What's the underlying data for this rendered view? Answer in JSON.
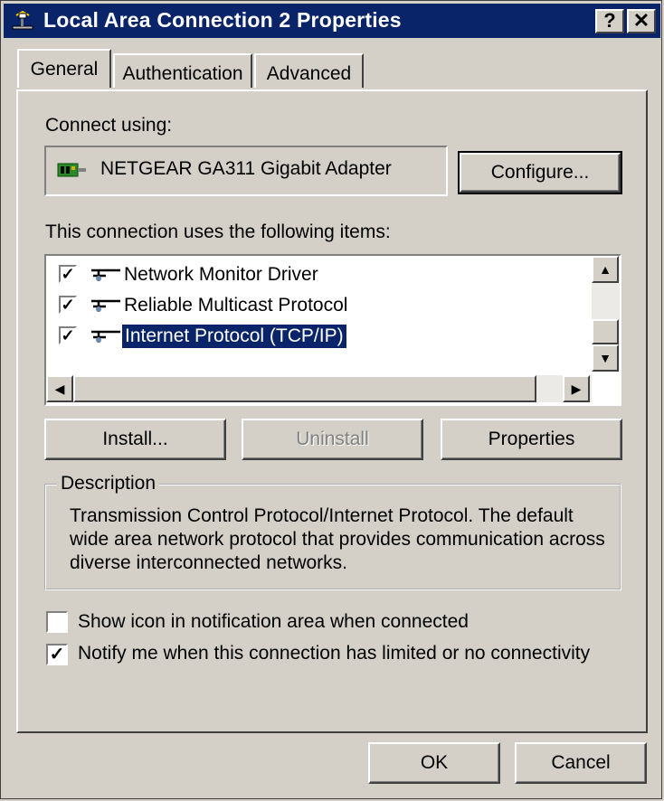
{
  "window": {
    "title": "Local Area Connection 2 Properties",
    "help_glyph": "?",
    "close_glyph": "✕"
  },
  "tabs": [
    {
      "label": "General"
    },
    {
      "label": "Authentication"
    },
    {
      "label": "Advanced"
    }
  ],
  "general": {
    "connect_using_label": "Connect using:",
    "adapter_name": "NETGEAR GA311 Gigabit Adapter",
    "configure_button": "Configure...",
    "items_label": "This connection uses the following items:",
    "items": [
      {
        "label": "Network Monitor Driver",
        "checked": true
      },
      {
        "label": "Reliable Multicast Protocol",
        "checked": true
      },
      {
        "label": "Internet Protocol (TCP/IP)",
        "checked": true,
        "selected": true
      }
    ],
    "install_button": "Install...",
    "uninstall_button": "Uninstall",
    "properties_button": "Properties",
    "description_title": "Description",
    "description_text": "Transmission Control Protocol/Internet Protocol. The default wide area network protocol that provides communication across diverse interconnected networks.",
    "show_icon_label": "Show icon in notification area when connected",
    "show_icon_checked": false,
    "notify_label": "Notify me when this connection has limited or no connectivity",
    "notify_checked": true
  },
  "footer": {
    "ok_button": "OK",
    "cancel_button": "Cancel"
  },
  "check_glyph": "✓",
  "colors": {
    "titlebar": "#0a246a",
    "face": "#d4d0c8",
    "selection": "#0a246a"
  }
}
